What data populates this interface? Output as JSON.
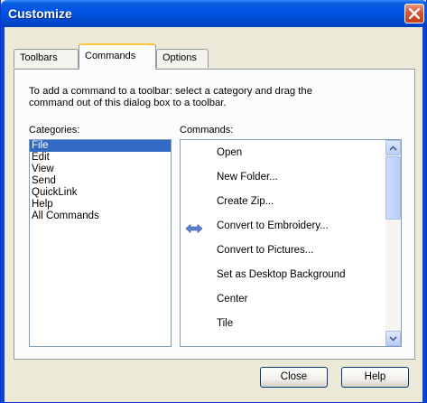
{
  "window": {
    "title": "Customize",
    "close_icon": "close-x-icon"
  },
  "tabs": [
    {
      "label": "Toolbars",
      "active": false
    },
    {
      "label": "Commands",
      "active": true
    },
    {
      "label": "Options",
      "active": false
    }
  ],
  "panel": {
    "intro_line1": "To add a command to a toolbar: select a category and drag the",
    "intro_line2": "command out of this dialog  box to a toolbar.",
    "categories_label": "Categories:",
    "commands_label": "Commands:"
  },
  "categories": [
    {
      "label": "File",
      "selected": true
    },
    {
      "label": "Edit",
      "selected": false
    },
    {
      "label": "View",
      "selected": false
    },
    {
      "label": "Send",
      "selected": false
    },
    {
      "label": "QuickLink",
      "selected": false
    },
    {
      "label": "Help",
      "selected": false
    },
    {
      "label": "All Commands",
      "selected": false
    }
  ],
  "commands": [
    {
      "label": "Open"
    },
    {
      "label": "New Folder..."
    },
    {
      "label": "Create Zip..."
    },
    {
      "label": "Convert to Embroidery...",
      "icon": "double-arrow-icon"
    },
    {
      "label": "Convert to Pictures..."
    },
    {
      "label": "Set as Desktop Background",
      "submenu": true
    },
    {
      "label": "Center"
    },
    {
      "label": "Tile"
    }
  ],
  "buttons": {
    "close": "Close",
    "help": "Help"
  },
  "colors": {
    "titlebar": "#0054e3",
    "selection": "#316ac5",
    "tab_highlight": "#ffc83c",
    "dialog_bg": "#ece9d8"
  }
}
